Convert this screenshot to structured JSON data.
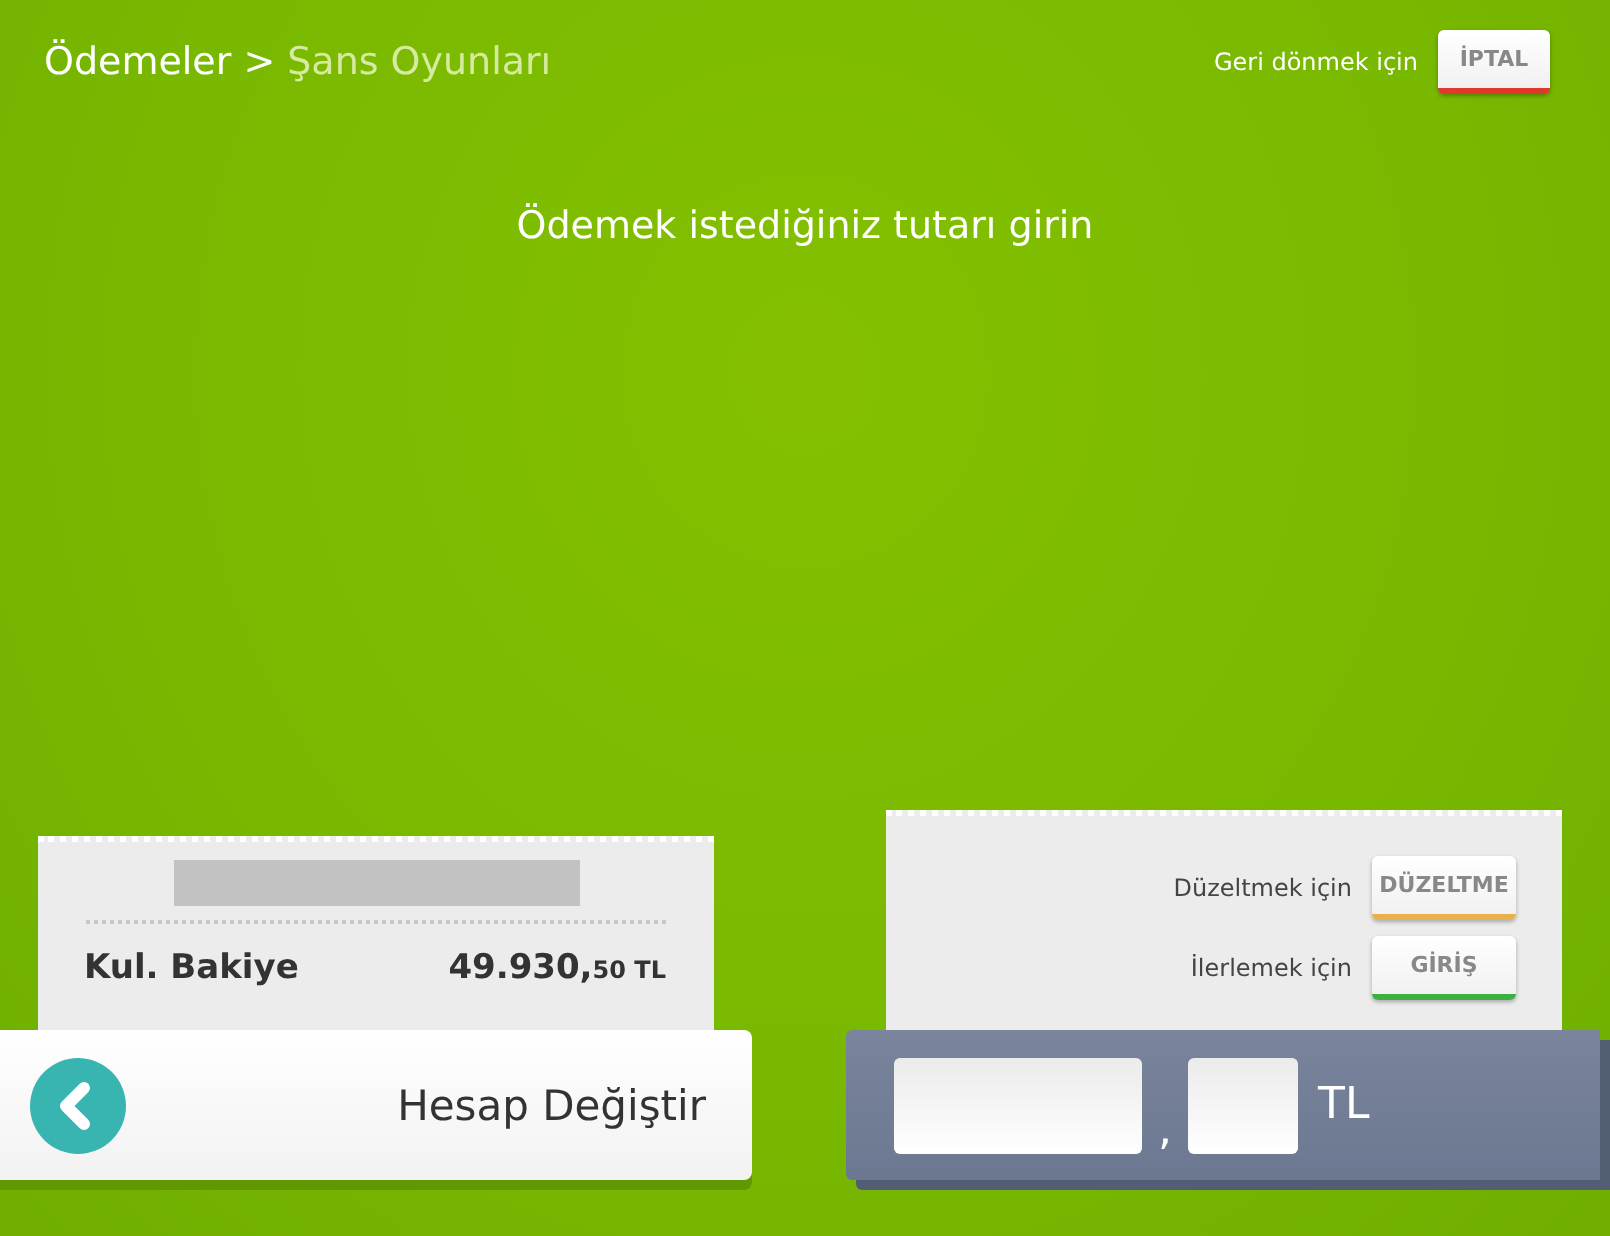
{
  "breadcrumb": {
    "items": [
      {
        "label": "Ödemeler",
        "current": false
      },
      {
        "label": "Şans Oyunları",
        "current": true
      }
    ],
    "separator": ">"
  },
  "cancel": {
    "hint": "Geri dönmek için",
    "button": "İPTAL",
    "color": "#e0392b"
  },
  "prompt": "Ödemek istediğiniz tutarı girin",
  "balance": {
    "label": "Kul. Bakiye",
    "amount": "49.930,",
    "cents": "50",
    "currency": "TL"
  },
  "change_account": {
    "label": "Hesap Değiştir"
  },
  "actions": [
    {
      "hint": "Düzeltmek için",
      "button": "DÜZELTME",
      "color": "#e8b04a"
    },
    {
      "hint": "İlerlemek için",
      "button": "GİRİŞ",
      "color": "#3cb043"
    }
  ],
  "amount_input": {
    "separator": ",",
    "currency": "TL"
  }
}
